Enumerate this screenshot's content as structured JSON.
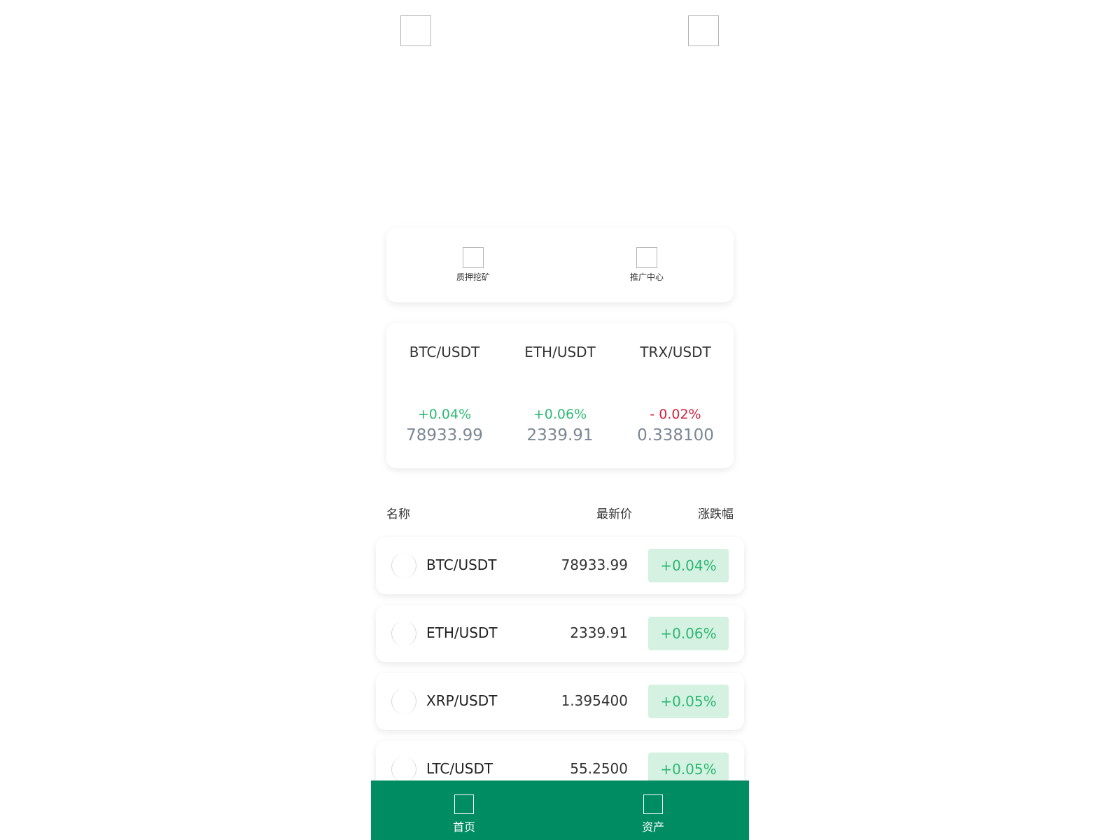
{
  "header": {
    "left_icon": "image-placeholder-icon",
    "right_icon": "image-placeholder-icon"
  },
  "quick_menu": [
    {
      "label": "质押挖矿",
      "icon": "staking-mining-icon"
    },
    {
      "label": "推广中心",
      "icon": "promotion-center-icon"
    }
  ],
  "ticker": [
    {
      "pair": "BTC/USDT",
      "change": "+0.04%",
      "price": "78933.99",
      "direction": "up"
    },
    {
      "pair": "ETH/USDT",
      "change": "+0.06%",
      "price": "2339.91",
      "direction": "up"
    },
    {
      "pair": "TRX/USDT",
      "change": "- 0.02%",
      "price": "0.338100",
      "direction": "down"
    }
  ],
  "list_header": {
    "name": "名称",
    "price": "最新价",
    "change": "涨跌幅"
  },
  "markets": [
    {
      "pair": "BTC/USDT",
      "price": "78933.99",
      "change": "+0.04%"
    },
    {
      "pair": "ETH/USDT",
      "price": "2339.91",
      "change": "+0.06%"
    },
    {
      "pair": "XRP/USDT",
      "price": "1.395400",
      "change": "+0.05%"
    },
    {
      "pair": "LTC/USDT",
      "price": "55.2500",
      "change": "+0.05%"
    }
  ],
  "tabbar": [
    {
      "label": "首页",
      "icon": "home-icon"
    },
    {
      "label": "资产",
      "icon": "assets-icon"
    }
  ],
  "colors": {
    "up": "#2cb871",
    "down": "#d0243e",
    "up_badge_bg": "#d4f1e2",
    "tabbar_bg": "#008c63",
    "muted_price": "#7b8794"
  }
}
